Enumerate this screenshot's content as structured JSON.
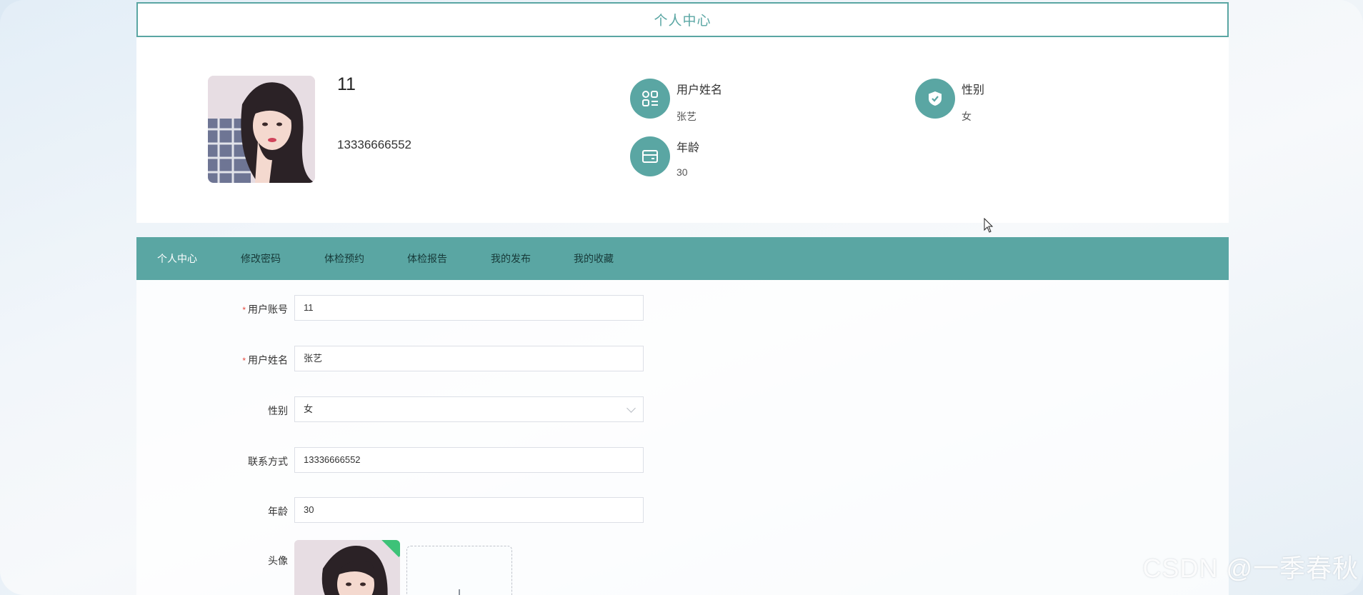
{
  "header": {
    "title": "个人中心"
  },
  "profile": {
    "username": "11",
    "phone": "13336666552",
    "fields": [
      {
        "label": "用户姓名",
        "value": "张艺",
        "icon": "grid-list-icon"
      },
      {
        "label": "性别",
        "value": "女",
        "icon": "shield-check-icon"
      },
      {
        "label": "年龄",
        "value": "30",
        "icon": "card-icon"
      }
    ]
  },
  "tabs": [
    {
      "label": "个人中心",
      "active": true
    },
    {
      "label": "修改密码",
      "active": false
    },
    {
      "label": "体检预约",
      "active": false
    },
    {
      "label": "体检报告",
      "active": false
    },
    {
      "label": "我的发布",
      "active": false
    },
    {
      "label": "我的收藏",
      "active": false
    }
  ],
  "form": {
    "account": {
      "label": "用户账号",
      "value": "11",
      "required": true
    },
    "name": {
      "label": "用户姓名",
      "value": "张艺",
      "required": true
    },
    "gender": {
      "label": "性别",
      "value": "女"
    },
    "contact": {
      "label": "联系方式",
      "value": "13336666552"
    },
    "age": {
      "label": "年龄",
      "value": "30"
    },
    "avatar": {
      "label": "头像"
    },
    "required_mark": "*"
  },
  "watermark": "CSDN @一季春秋",
  "colors": {
    "accent": "#5aa6a3",
    "tab_text": "#173a39",
    "required": "#e5483d",
    "upload_success": "#3dc278"
  }
}
